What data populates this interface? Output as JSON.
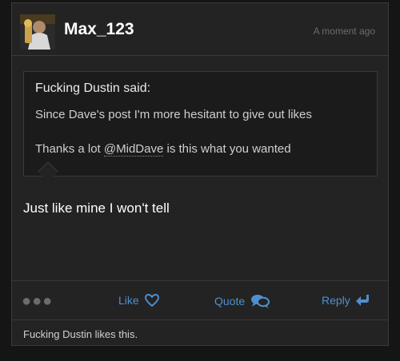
{
  "post": {
    "username": "Max_123",
    "timestamp": "A moment ago",
    "quote": {
      "author": "Fucking Dustin said:",
      "line1": "Since Dave's post I'm more hesitant to give out likes",
      "line2_prefix": "Thanks a lot ",
      "mention": "@MidDave",
      "line2_suffix": " is this what you wanted"
    },
    "message": "Just like mine I won't tell",
    "actions": {
      "more": "●●●",
      "like": "Like",
      "quote": "Quote",
      "reply": "Reply"
    },
    "likes_summary": "Fucking Dustin likes this."
  },
  "colors": {
    "background": "#151515",
    "card": "#232323",
    "border": "#3a3a3a",
    "accent": "#4f8fd0"
  },
  "icons": {
    "like": "heart-icon",
    "quote": "speech-bubbles-icon",
    "reply": "reply-arrow-icon"
  }
}
